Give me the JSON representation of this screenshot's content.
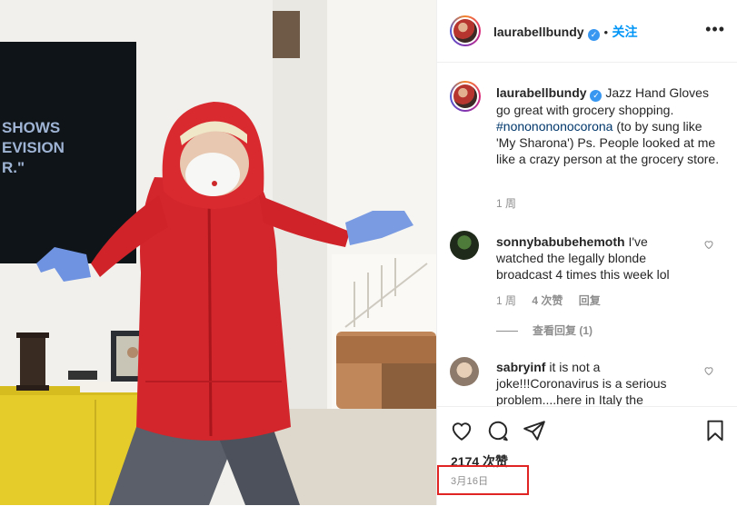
{
  "post": {
    "username": "laurabellbundy",
    "follow_label": "关注",
    "more_label": "•••",
    "dot_separator": "•"
  },
  "caption": {
    "username": "laurabellbundy",
    "text_before_tag": "Jazz Hand Gloves go great with grocery shopping.",
    "hashtag": "#nononononocorona",
    "text_after_tag": "(to by sung like 'My Sharona') Ps. People looked at me like a crazy person at the grocery store.",
    "time": "1 周"
  },
  "tv_text": [
    "SHOWS",
    "EVISION",
    "R.\""
  ],
  "comments": [
    {
      "username": "sonnybabubehemoth",
      "text": "I've watched the legally blonde broadcast 4 times this week lol",
      "time": "1 周",
      "likes": "4 次赞",
      "reply": "回复",
      "view_replies": "查看回复 (1)"
    },
    {
      "username": "sabryinf",
      "text": "it is not a joke!!!Coronavirus is a serious problem....here in Italy the",
      "time": "",
      "likes": "",
      "reply": ""
    }
  ],
  "actions": {
    "likes_count": "2174 次赞",
    "date": "3月16日"
  },
  "colors": {
    "link": "#0095f6",
    "verified": "#3897f0",
    "highlight_box": "#e02424"
  }
}
